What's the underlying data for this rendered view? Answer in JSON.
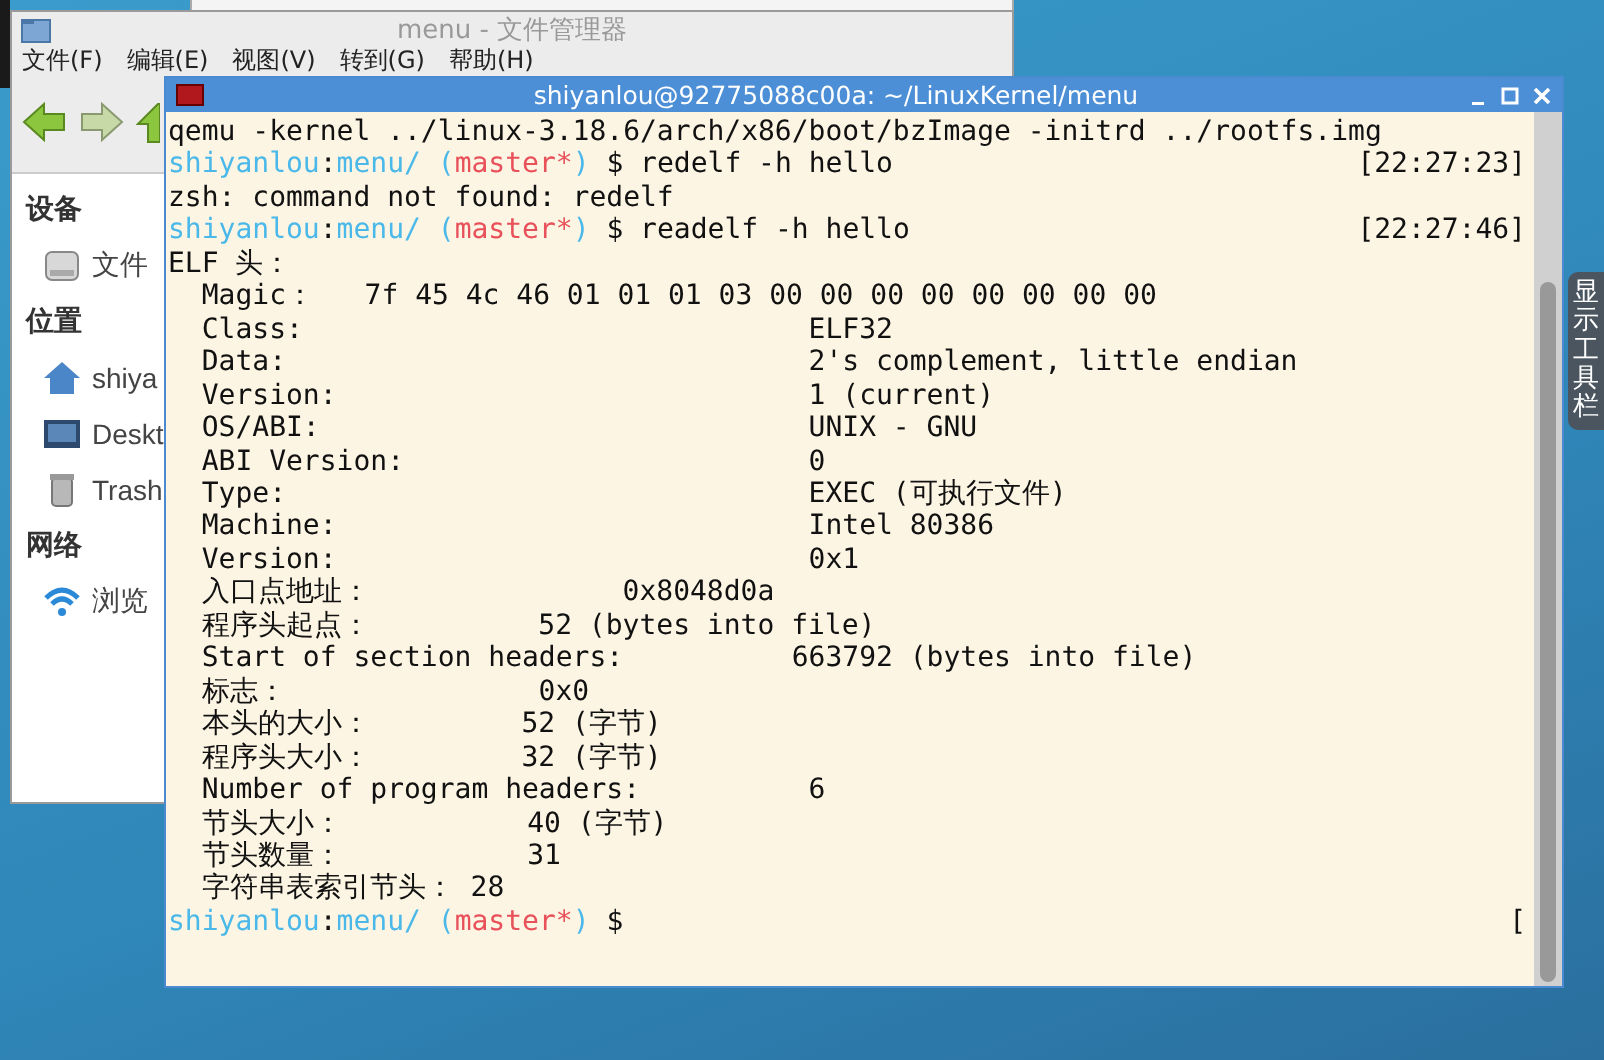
{
  "file_manager": {
    "title": "menu - 文件管理器",
    "menu": [
      "文件(F)",
      "编辑(E)",
      "视图(V)",
      "转到(G)",
      "帮助(H)"
    ],
    "toolbar": [
      {
        "kind": "back"
      },
      {
        "kind": "forward"
      },
      {
        "kind": "up"
      }
    ],
    "sidebar": [
      {
        "heading": "设备",
        "items": [
          {
            "label": "文件",
            "kind": "drive"
          }
        ]
      },
      {
        "heading": "位置",
        "items": [
          {
            "label": "shiya",
            "kind": "home"
          },
          {
            "label": "Deskt",
            "kind": "desktop"
          },
          {
            "label": "Trash",
            "kind": "trash"
          }
        ]
      },
      {
        "heading": "网络",
        "items": [
          {
            "label": "浏览",
            "kind": "network"
          }
        ]
      }
    ]
  },
  "terminal": {
    "title": "shiyanlou@92775088c00a: ~/LinuxKernel/menu",
    "lines": [
      {
        "kind": "output",
        "text": "qemu -kernel ../linux-3.18.6/arch/x86/boot/bzImage -initrd ../rootfs.img"
      },
      {
        "kind": "prompt",
        "user": "shiyanlou",
        "sep": ":",
        "path": "menu/",
        "open": " (",
        "branch": "master*",
        "close": ")",
        "symbol": " $ ",
        "command": "redelf -h hello",
        "time": "[22:27:23]"
      },
      {
        "kind": "output",
        "text": "zsh: command not found: redelf"
      },
      {
        "kind": "prompt",
        "user": "shiyanlou",
        "sep": ":",
        "path": "menu/",
        "open": " (",
        "branch": "master*",
        "close": ")",
        "symbol": " $ ",
        "command": "readelf -h hello",
        "time": "[22:27:46]"
      },
      {
        "kind": "output",
        "text": "ELF 头："
      },
      {
        "kind": "output",
        "text": "  Magic：   7f 45 4c 46 01 01 01 03 00 00 00 00 00 00 00 00"
      },
      {
        "kind": "output",
        "text": "  Class:                              ELF32"
      },
      {
        "kind": "output",
        "text": "  Data:                               2's complement, little endian"
      },
      {
        "kind": "output",
        "text": "  Version:                            1 (current)"
      },
      {
        "kind": "output",
        "text": "  OS/ABI:                             UNIX - GNU"
      },
      {
        "kind": "output",
        "text": "  ABI Version:                        0"
      },
      {
        "kind": "output",
        "text": "  Type:                               EXEC (可执行文件)"
      },
      {
        "kind": "output",
        "text": "  Machine:                            Intel 80386"
      },
      {
        "kind": "output",
        "text": "  Version:                            0x1"
      },
      {
        "kind": "output",
        "text": "  入口点地址：               0x8048d0a"
      },
      {
        "kind": "output",
        "text": "  程序头起点：          52 (bytes into file)"
      },
      {
        "kind": "output",
        "text": "  Start of section headers:          663792 (bytes into file)"
      },
      {
        "kind": "output",
        "text": "  标志：               0x0"
      },
      {
        "kind": "output",
        "text": "  本头的大小：         52 (字节)"
      },
      {
        "kind": "output",
        "text": "  程序头大小：         32 (字节)"
      },
      {
        "kind": "output",
        "text": "  Number of program headers:          6"
      },
      {
        "kind": "output",
        "text": "  节头大小：           40 (字节)"
      },
      {
        "kind": "output",
        "text": "  节头数量：           31"
      },
      {
        "kind": "output",
        "text": "  字符串表索引节头： 28"
      },
      {
        "kind": "prompt",
        "user": "shiyanlou",
        "sep": ":",
        "path": "menu/",
        "open": " (",
        "branch": "master*",
        "close": ")",
        "symbol": " $",
        "time": "["
      }
    ]
  },
  "side_tab": {
    "label": "显示工具栏"
  }
}
